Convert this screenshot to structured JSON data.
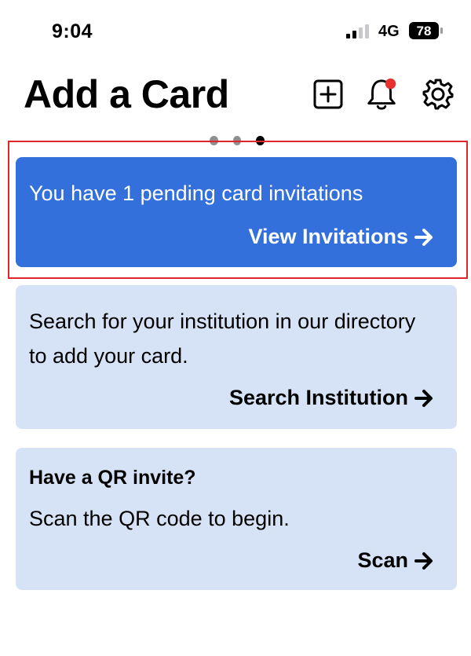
{
  "status_bar": {
    "time": "9:04",
    "network": "4G",
    "battery_level": "78"
  },
  "header": {
    "title": "Add a Card",
    "icons": [
      "plus-square-icon",
      "bell-icon",
      "gear-icon"
    ],
    "notification_dot_color": "#e8302e"
  },
  "pager": {
    "total_pages": 3,
    "active_index": 2
  },
  "cards": {
    "invitations": {
      "text": "You have 1 pending card invitations",
      "action": "View Invitations",
      "bg_color": "#3370db"
    },
    "search": {
      "text": "Search for your institution in our directory to add your card.",
      "action": "Search Institution",
      "bg_color": "#d6e2f5"
    },
    "qr": {
      "title": "Have a QR  invite?",
      "text": "Scan the QR code to begin.",
      "action": "Scan",
      "bg_color": "#d6e2f5"
    }
  },
  "highlight_color": "#e0262b"
}
